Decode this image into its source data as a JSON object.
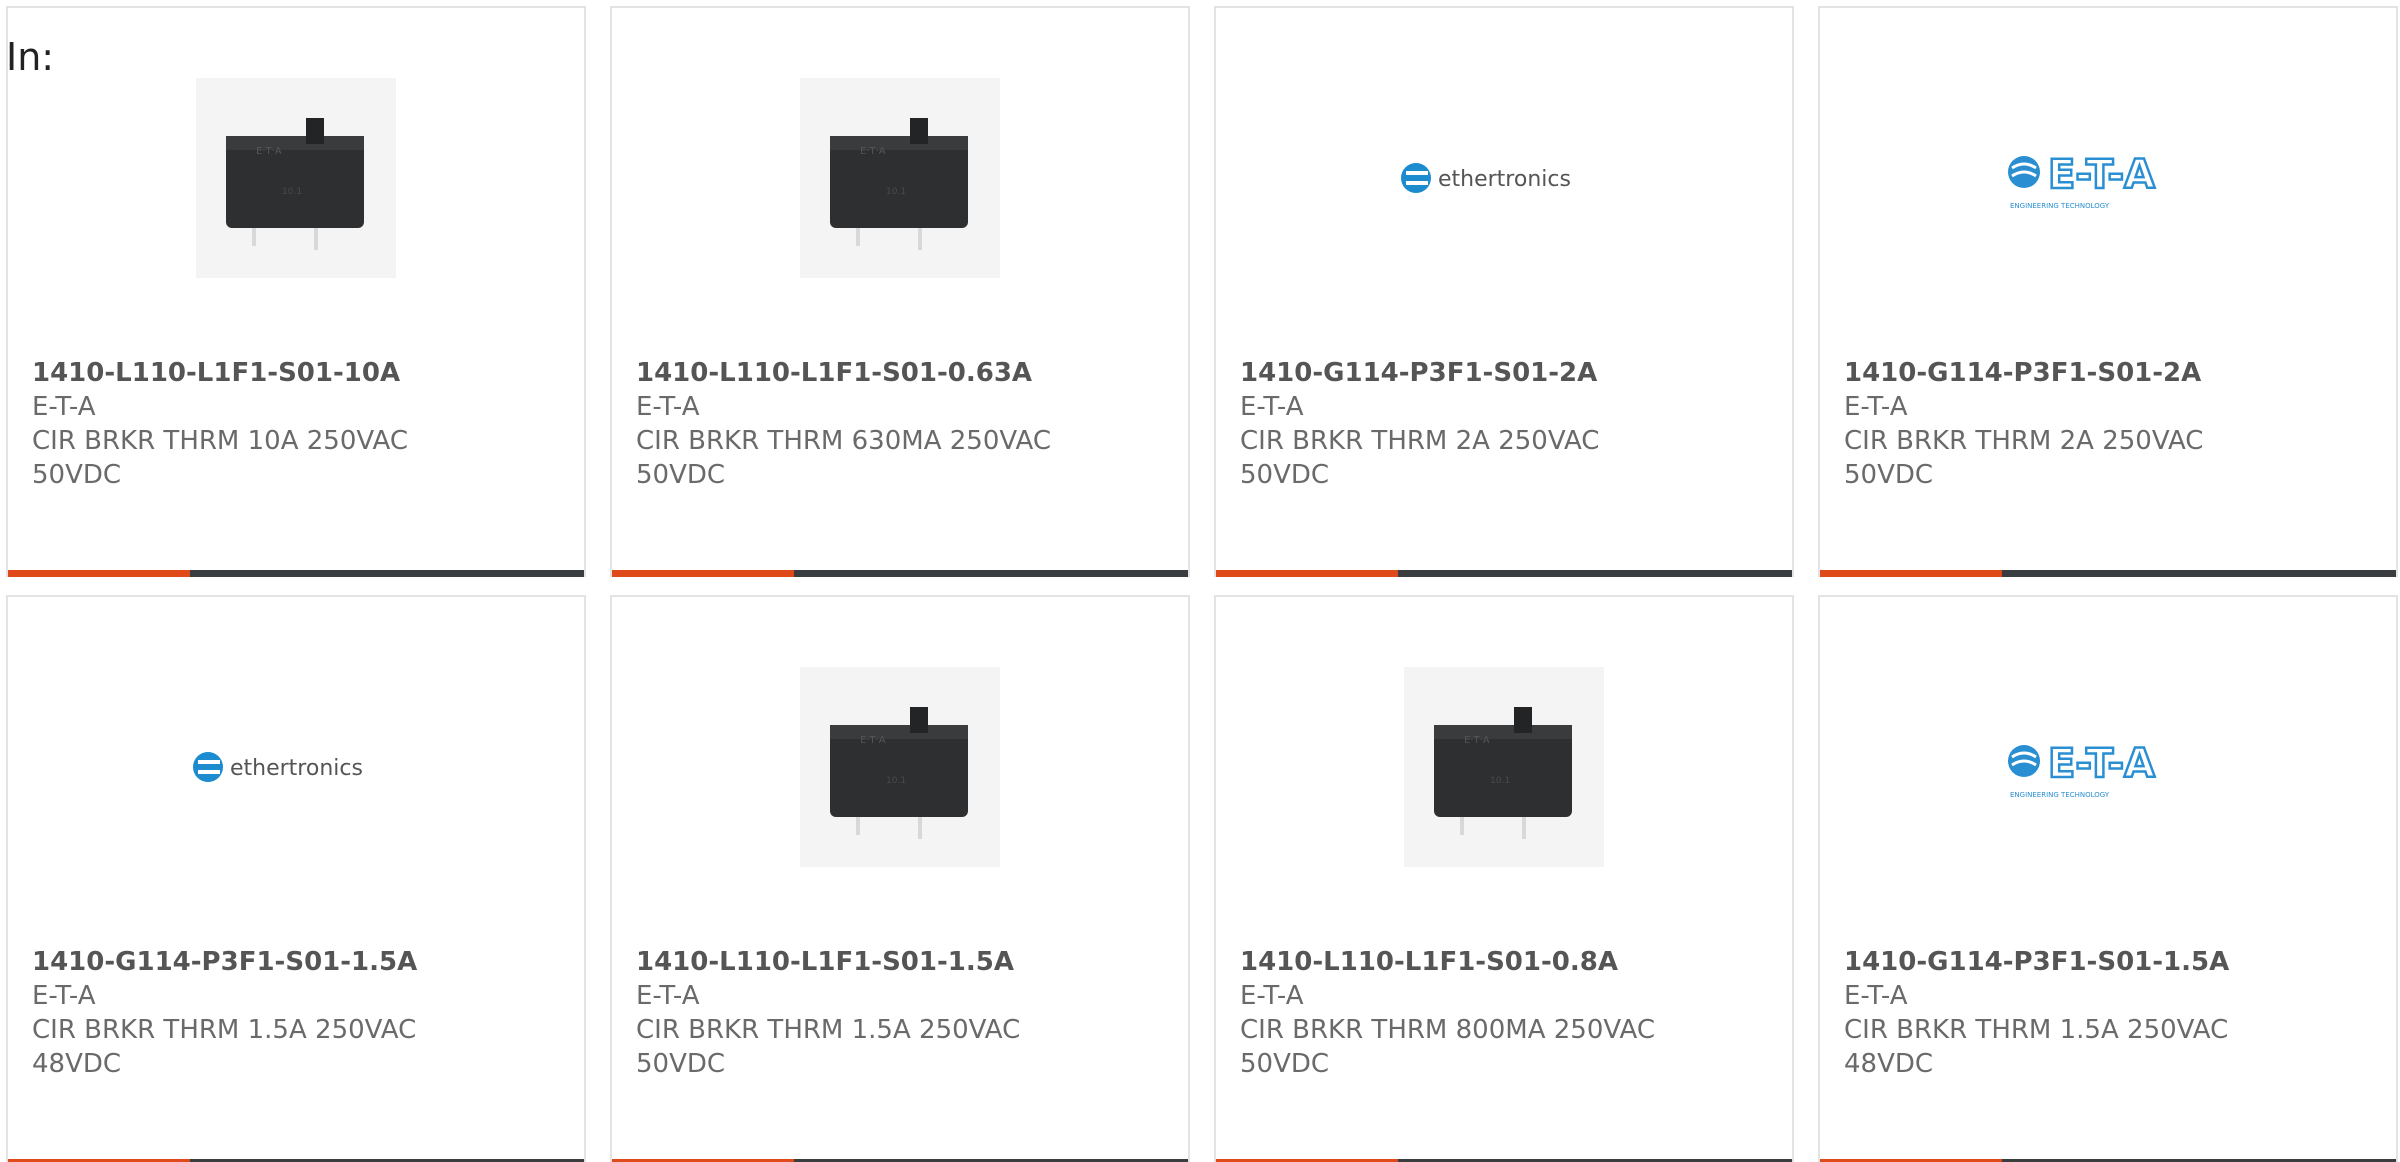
{
  "header": {
    "label": "In:"
  },
  "colors": {
    "accent": "#e04a1b",
    "bar": "#3a3d3f",
    "border": "#e3e3e3",
    "text": "#6a6a6a"
  },
  "products": [
    {
      "part_number": "1410-L110-L1F1-S01-10A",
      "manufacturer": "E-T-A",
      "description": "CIR BRKR THRM 10A 250VAC\n50VDC",
      "image": "breaker-photo"
    },
    {
      "part_number": "1410-L110-L1F1-S01-0.63A",
      "manufacturer": "E-T-A",
      "description": "CIR BRKR THRM 630MA 250VAC\n50VDC",
      "image": "breaker-photo"
    },
    {
      "part_number": "1410-G114-P3F1-S01-2A",
      "manufacturer": "E-T-A",
      "description": "CIR BRKR THRM 2A 250VAC\n50VDC",
      "image": "ethertronics-logo"
    },
    {
      "part_number": "1410-G114-P3F1-S01-2A",
      "manufacturer": "E-T-A",
      "description": "CIR BRKR THRM 2A 250VAC\n50VDC",
      "image": "eta-logo"
    },
    {
      "part_number": "1410-G114-P3F1-S01-1.5A",
      "manufacturer": "E-T-A",
      "description": "CIR BRKR THRM 1.5A 250VAC\n48VDC",
      "image": "ethertronics-logo"
    },
    {
      "part_number": "1410-L110-L1F1-S01-1.5A",
      "manufacturer": "E-T-A",
      "description": "CIR BRKR THRM 1.5A 250VAC\n50VDC",
      "image": "breaker-photo"
    },
    {
      "part_number": "1410-L110-L1F1-S01-0.8A",
      "manufacturer": "E-T-A",
      "description": "CIR BRKR THRM 800MA 250VAC\n50VDC",
      "image": "breaker-photo"
    },
    {
      "part_number": "1410-G114-P3F1-S01-1.5A",
      "manufacturer": "E-T-A",
      "description": "CIR BRKR THRM 1.5A 250VAC\n48VDC",
      "image": "eta-logo"
    }
  ],
  "logos": {
    "ethertronics": "ethertronics",
    "eta": "E-T-A",
    "eta_tagline": "ENGINEERING TECHNOLOGY"
  }
}
